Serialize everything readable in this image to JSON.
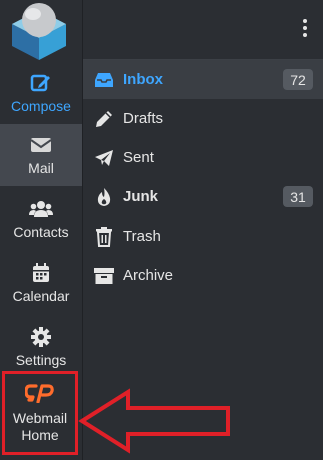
{
  "rail": {
    "compose_label": "Compose",
    "mail_label": "Mail",
    "contacts_label": "Contacts",
    "calendar_label": "Calendar",
    "settings_label": "Settings",
    "webmail_home_label_line1": "Webmail",
    "webmail_home_label_line2": "Home"
  },
  "folders": [
    {
      "label": "Inbox",
      "count": "72",
      "icon": "inbox-icon"
    },
    {
      "label": "Drafts",
      "icon": "pencil-icon"
    },
    {
      "label": "Sent",
      "icon": "paper-plane-icon"
    },
    {
      "label": "Junk",
      "count": "31",
      "icon": "fire-icon"
    },
    {
      "label": "Trash",
      "icon": "trash-icon"
    },
    {
      "label": "Archive",
      "icon": "archive-icon"
    }
  ],
  "colors": {
    "accent": "#3ea6ff",
    "cpanel_orange": "#ff6c2c",
    "highlight_red": "#e02028"
  }
}
